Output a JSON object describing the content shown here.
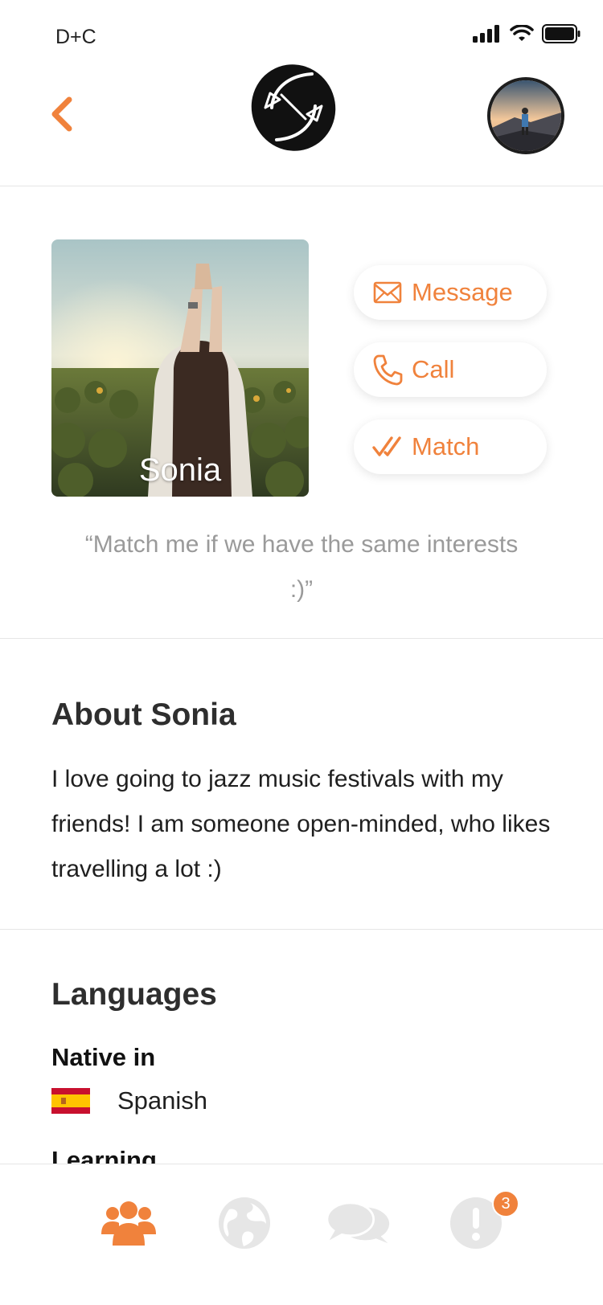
{
  "status_bar": {
    "carrier": "D+C",
    "icons": [
      "signal-icon",
      "wifi-icon",
      "battery-icon"
    ]
  },
  "header": {
    "back_icon": "chevron-left-icon",
    "logo_icon": "swap-arrows-logo",
    "avatar_image": "user-avatar-mountain"
  },
  "profile": {
    "name": "Sonia",
    "photo": "woman-in-sunflower-field",
    "quote": "“Match me if we have the same interests :)”"
  },
  "actions": [
    {
      "label": "Message",
      "icon": "envelope-icon"
    },
    {
      "label": "Call",
      "icon": "phone-icon"
    },
    {
      "label": "Match",
      "icon": "double-check-icon"
    }
  ],
  "about": {
    "title": "About Sonia",
    "text": "I love going to jazz music festivals with my friends! I am someone open-minded, who likes travelling a lot :)"
  },
  "languages": {
    "title": "Languages",
    "native_label": "Native in",
    "native": [
      {
        "name": "Spanish",
        "flag": "spain-flag-icon"
      }
    ],
    "learning_label": "Learning"
  },
  "tab_bar": {
    "tabs": [
      {
        "icon": "people-icon",
        "active": true
      },
      {
        "icon": "globe-icon",
        "active": false
      },
      {
        "icon": "chat-bubbles-icon",
        "active": false
      },
      {
        "icon": "alert-icon",
        "active": false,
        "badge": "3"
      }
    ]
  },
  "colors": {
    "accent": "#f0823c",
    "text_dark": "#2e2e2e",
    "text_muted": "#9a9a9a",
    "tab_inactive": "#e6e6e6",
    "divider": "#e6e6e6"
  }
}
